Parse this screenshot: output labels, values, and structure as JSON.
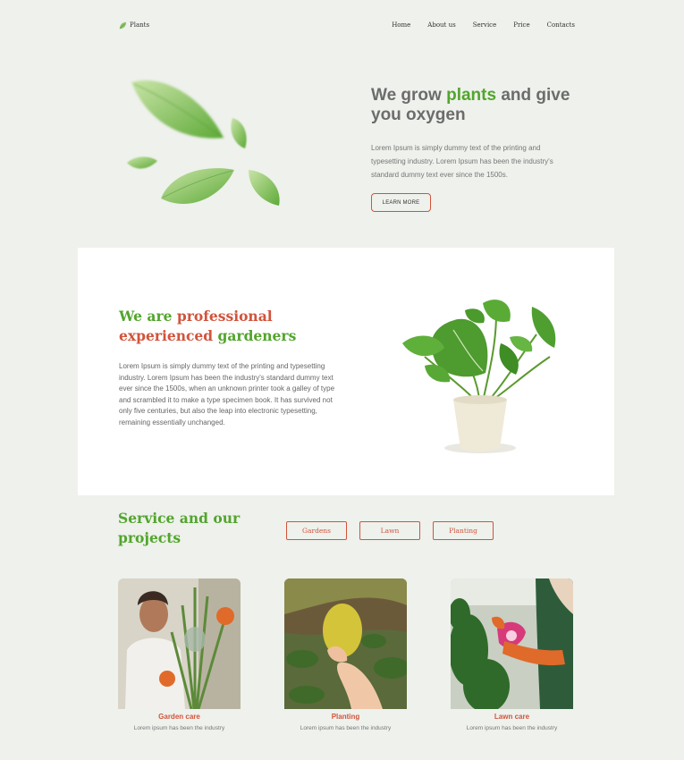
{
  "brand": {
    "name": "Plants",
    "icon": "leaf-icon"
  },
  "nav": {
    "items": [
      "Home",
      "About us",
      "Service",
      "Price",
      "Contacts"
    ]
  },
  "hero": {
    "title_before": "We grow ",
    "title_accent": "plants",
    "title_after": " and give you oxygen",
    "text": "Lorem Ipsum is simply dummy text of the printing and typesetting industry. Lorem Ipsum has been the industry's standard dummy text ever since the 1500s.",
    "button": "LEARN MORE"
  },
  "about": {
    "title_p1": "We are ",
    "title_p2": "professional experienced",
    "title_p3": " gardeners",
    "text": "Lorem Ipsum is simply dummy text of the printing and typesetting industry. Lorem Ipsum has been the industry's standard dummy text ever since the 1500s, when an unknown printer took a galley of type and scrambled it to make a type specimen book. It has survived not only five centuries, but also the leap into electronic typesetting, remaining essentially unchanged."
  },
  "services": {
    "title": "Service and our projects",
    "filters": [
      "Gardens",
      "Lawn",
      "Planting"
    ],
    "cards": [
      {
        "title": "Garden care",
        "subtitle": "Lorem ipsum has been the industry"
      },
      {
        "title": "Planting",
        "subtitle": "Lorem ipsum has been the industry"
      },
      {
        "title": "Lawn care",
        "subtitle": "Lorem ipsum has been the industry"
      }
    ]
  },
  "colors": {
    "accent_green": "#52a52d",
    "accent_red": "#d1543c",
    "background": "#eef1ec"
  }
}
